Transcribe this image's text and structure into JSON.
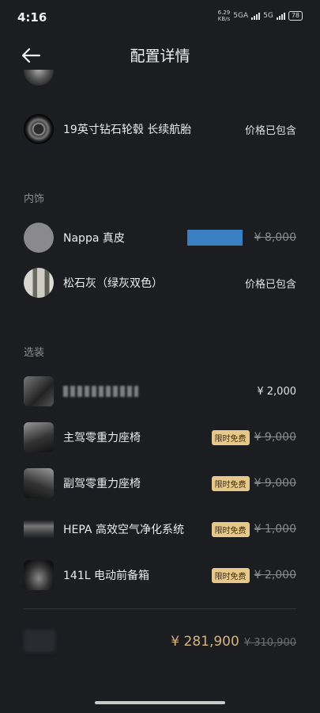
{
  "status": {
    "time": "4:16",
    "net_speed": "6.29",
    "net_unit": "KB/s",
    "network_1": "5GA",
    "network_2": "5G",
    "battery": "78"
  },
  "header": {
    "title": "配置详情"
  },
  "rows_top": [
    {
      "label": "19英寸钻石轮毂 长续航胎",
      "price": "价格已包含"
    }
  ],
  "section_interior": {
    "title": "内饰",
    "items": [
      {
        "label": "Nappa 真皮",
        "price": "¥ 8,000"
      },
      {
        "label": "松石灰（绿灰双色）",
        "price": "价格已包含"
      }
    ]
  },
  "section_options": {
    "title": "选装",
    "items": [
      {
        "label": "",
        "price": "¥ 2,000"
      },
      {
        "label": "主驾零重力座椅",
        "badge": "限时免费",
        "price": "¥ 9,000"
      },
      {
        "label": "副驾零重力座椅",
        "badge": "限时免费",
        "price": "¥ 9,000"
      },
      {
        "label": "HEPA 高效空气净化系统",
        "badge": "限时免费",
        "price": "¥ 1,000"
      },
      {
        "label": "141L 电动前备箱",
        "badge": "限时免费",
        "price": "¥ 2,000"
      }
    ]
  },
  "footer": {
    "total": "¥ 281,900",
    "original_total": "¥ 310,900"
  },
  "colors": {
    "background": "#1c1d21",
    "accent_gold": "#d6b47a",
    "badge_bg": "#e6c98a",
    "highlight_blue": "#3a7fc4"
  }
}
